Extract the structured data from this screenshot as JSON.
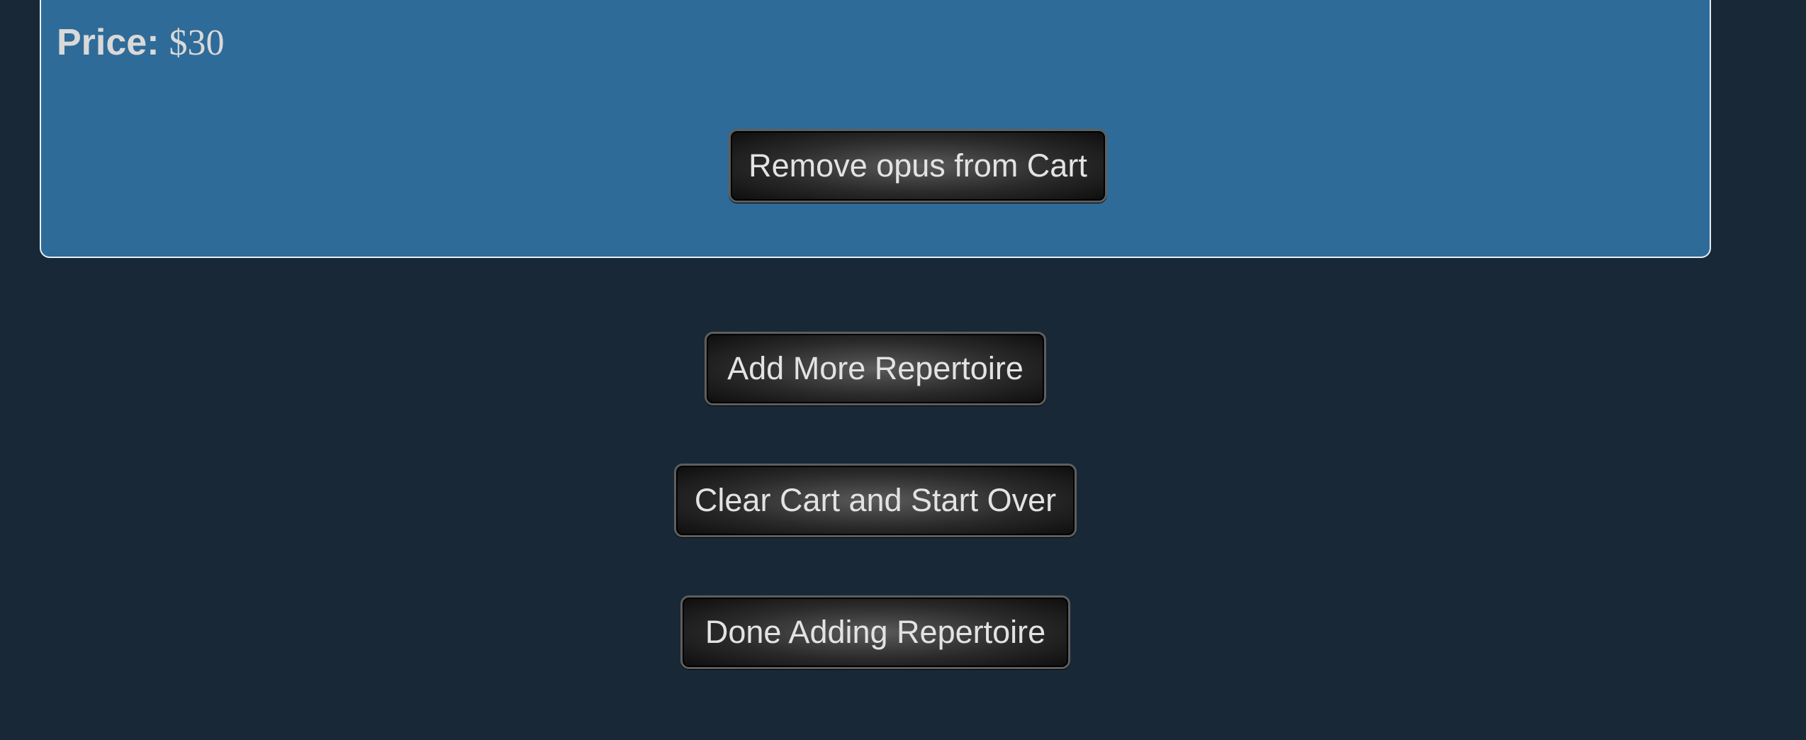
{
  "cart_item": {
    "price_label": "Price:",
    "price_value": "$30",
    "remove_button_label": "Remove opus from Cart"
  },
  "actions": {
    "add_more_label": "Add More Repertoire",
    "clear_cart_label": "Clear Cart and Start Over",
    "done_label": "Done Adding Repertoire"
  },
  "colors": {
    "page_background": "#182836",
    "panel_background": "#2e6b98",
    "panel_border": "#e6eef5",
    "text": "#d9d9d9",
    "button_dark": "#0d0d0d"
  }
}
